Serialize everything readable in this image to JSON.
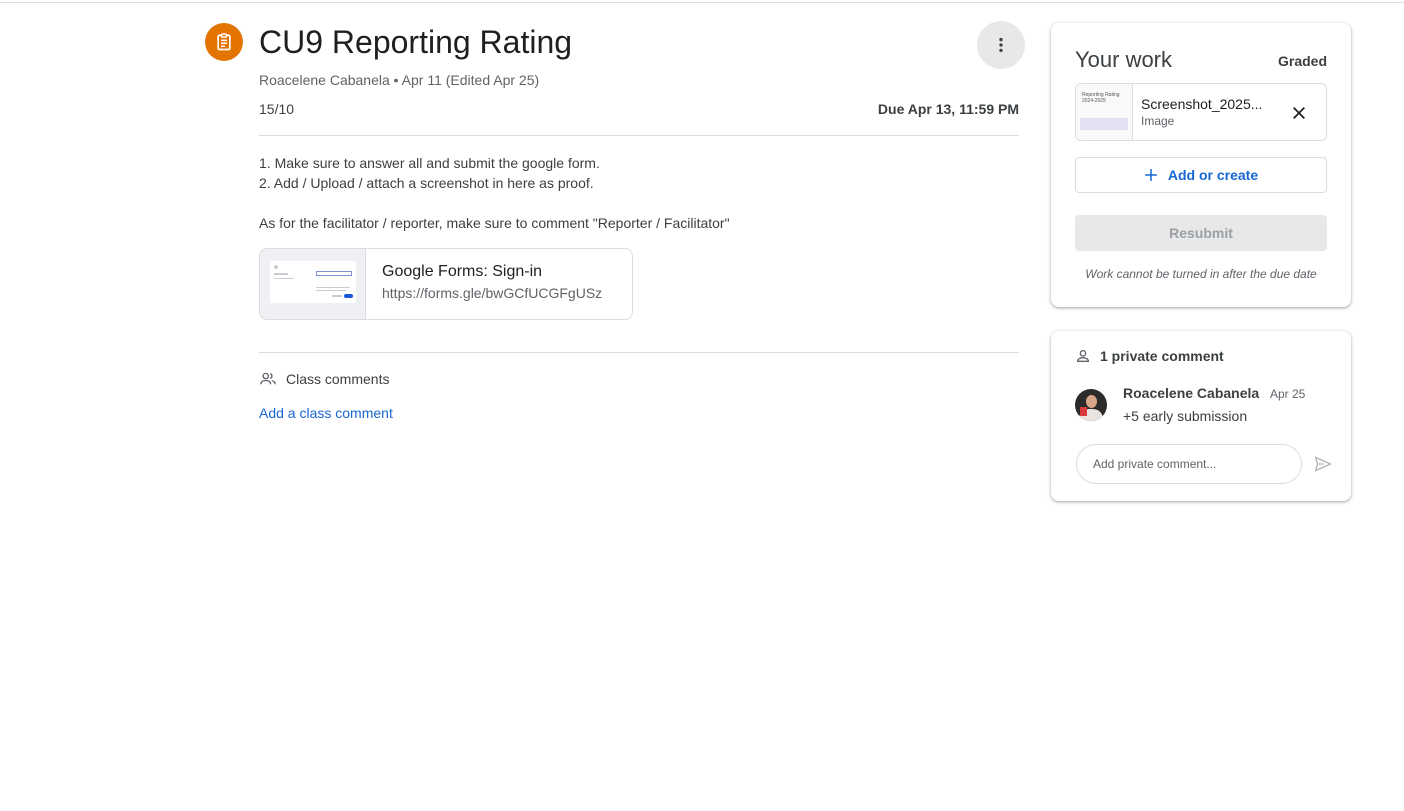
{
  "assignment": {
    "title": "CU9 Reporting Rating",
    "meta": "Roacelene Cabanela • Apr 11 (Edited Apr 25)",
    "points": "15/10",
    "due": "Due Apr 13, 11:59 PM",
    "icon": "assignment-icon",
    "accent_color": "#e37400"
  },
  "instructions": {
    "line1": "1. Make sure to answer all and submit the google form.",
    "line2": "2. Add / Upload / attach a screenshot in here as proof.",
    "line3": "As for the facilitator / reporter, make sure to comment \"Reporter / Facilitator\""
  },
  "attachment": {
    "title": "Google Forms: Sign-in",
    "url": "https://forms.gle/bwGCfUCGFgUSz"
  },
  "class_comments": {
    "label": "Class comments",
    "add_link": "Add a class comment"
  },
  "your_work": {
    "title": "Your work",
    "status": "Graded",
    "file": {
      "name": "Screenshot_2025...",
      "type": "Image",
      "thumb_text": "Reporting Rating 2024-2025"
    },
    "add_create_label": "Add or create",
    "resubmit_label": "Resubmit",
    "note": "Work cannot be turned in after the due date"
  },
  "private_comments": {
    "header": "1 private comment",
    "comments": [
      {
        "author": "Roacelene Cabanela",
        "date": "Apr 25",
        "text": "+5 early submission"
      }
    ],
    "input_placeholder": "Add private comment..."
  },
  "colors": {
    "link_blue": "#1967d2",
    "text": "#3c4043",
    "divider": "#dadce0"
  }
}
